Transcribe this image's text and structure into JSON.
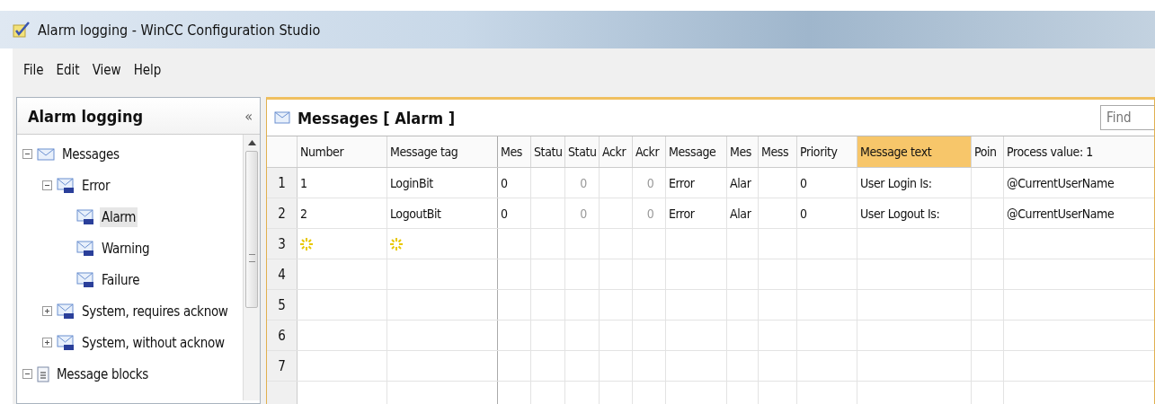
{
  "window": {
    "title": "Alarm logging - WinCC Configuration Studio"
  },
  "menu": [
    {
      "label": "File"
    },
    {
      "label": "Edit"
    },
    {
      "label": "View"
    },
    {
      "label": "Help"
    }
  ],
  "navigation": {
    "title": "Alarm logging",
    "collapse": "«",
    "tree": [
      {
        "label": "Messages",
        "kind": "mail",
        "expanded": true,
        "selected": false,
        "children": [
          {
            "label": "Error",
            "kind": "class",
            "expanded": true,
            "selected": false,
            "children": [
              {
                "label": "Alarm",
                "kind": "class",
                "selected": true
              },
              {
                "label": "Warning",
                "kind": "class",
                "selected": false
              },
              {
                "label": "Failure",
                "kind": "class",
                "selected": false
              }
            ]
          },
          {
            "label": "System, requires acknow",
            "kind": "class",
            "expanded": false,
            "selected": false
          },
          {
            "label": "System, without acknow",
            "kind": "class",
            "expanded": false,
            "selected": false
          }
        ]
      },
      {
        "label": "Message blocks",
        "kind": "list",
        "expanded": true,
        "selected": false
      }
    ]
  },
  "editor": {
    "title": "Messages [ Alarm ]",
    "search": {
      "placeholder": "Find"
    },
    "columns": [
      {
        "label": "Number",
        "selected": false
      },
      {
        "label": "Message tag",
        "selected": false
      },
      {
        "label": "Mes",
        "selected": false
      },
      {
        "label": "Statu",
        "selected": false
      },
      {
        "label": "Statu",
        "selected": false
      },
      {
        "label": "Ackr",
        "selected": false
      },
      {
        "label": "Ackr",
        "selected": false
      },
      {
        "label": "Message",
        "selected": false
      },
      {
        "label": "Mes",
        "selected": false
      },
      {
        "label": "Mess",
        "selected": false
      },
      {
        "label": "Priority",
        "selected": false
      },
      {
        "label": "Message text",
        "selected": true
      },
      {
        "label": "Poin",
        "selected": false
      },
      {
        "label": "Process value:  1",
        "selected": false
      }
    ],
    "rows": [
      {
        "index": "1",
        "kind": "data",
        "cells": [
          {
            "text": "1",
            "disabled": false
          },
          {
            "text": "LoginBit",
            "disabled": false
          },
          {
            "text": "0",
            "disabled": false
          },
          null,
          {
            "text": "0",
            "disabled": true
          },
          null,
          {
            "text": "0",
            "disabled": true
          },
          {
            "text": "Error",
            "disabled": false
          },
          {
            "text": "Alar",
            "disabled": false
          },
          null,
          {
            "text": "0",
            "disabled": false
          },
          {
            "text": "User Login Is:",
            "disabled": false
          },
          null,
          {
            "text": "@CurrentUserName",
            "disabled": false
          }
        ]
      },
      {
        "index": "2",
        "kind": "data",
        "cells": [
          {
            "text": "2",
            "disabled": false
          },
          {
            "text": "LogoutBit",
            "disabled": false
          },
          {
            "text": "0",
            "disabled": false
          },
          null,
          {
            "text": "0",
            "disabled": true
          },
          null,
          {
            "text": "0",
            "disabled": true
          },
          {
            "text": "Error",
            "disabled": false
          },
          {
            "text": "Alar",
            "disabled": false
          },
          null,
          {
            "text": "0",
            "disabled": false
          },
          {
            "text": "User Logout Is:",
            "disabled": false
          },
          null,
          {
            "text": "@CurrentUserName",
            "disabled": false
          }
        ]
      },
      {
        "index": "3",
        "kind": "new"
      },
      {
        "index": "4",
        "kind": "empty"
      },
      {
        "index": "5",
        "kind": "empty"
      },
      {
        "index": "6",
        "kind": "empty"
      },
      {
        "index": "7",
        "kind": "empty"
      }
    ]
  }
}
